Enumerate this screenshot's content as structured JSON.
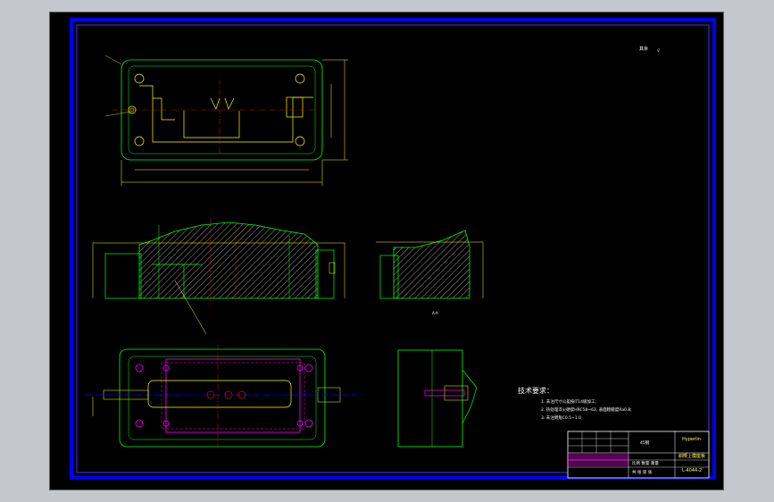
{
  "drawing": {
    "roughness_label": "其余",
    "roughness_symbol": "√",
    "section_label": "A-A",
    "notes": {
      "title": "技术要求：",
      "lines": [
        "1. 未注尺寸公差按IT14级加工;",
        "2. 热处理淬火硬度HRC58~62, 表面粗糙度Ra0.8;",
        "3. 未注倒角C0.5~1.0"
      ]
    },
    "title_block": {
      "material": "45钢",
      "company": "Hyperlin",
      "part_name": "斜楔上模座板",
      "drawing_no": "L-4044-2",
      "scale_label": "比例 数量 重量",
      "sheet_label": "共 张 第 张"
    }
  },
  "colors": {
    "background": "#000000",
    "border": "#0000ff",
    "outline_green": "#00ff00",
    "dimension_yellow": "#ffff00",
    "center_red": "#ff0000",
    "bolt_magenta": "#ff00ff",
    "axis_blue": "#0000ff",
    "text_white": "#ffffff"
  }
}
